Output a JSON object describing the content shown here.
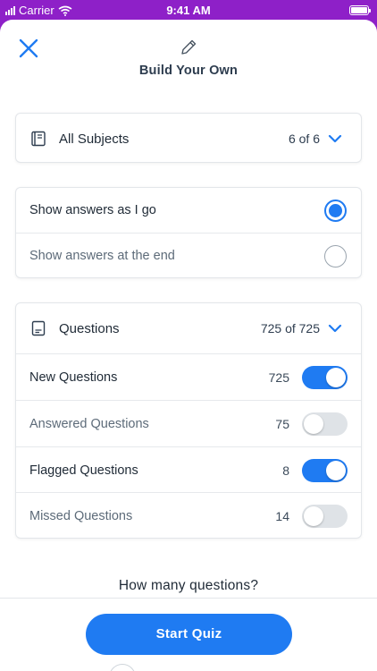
{
  "status_bar": {
    "carrier": "Carrier",
    "time": "9:41 AM"
  },
  "header": {
    "title": "Build Your Own"
  },
  "subjects": {
    "label": "All Subjects",
    "count": "6 of 6"
  },
  "answers": {
    "options": [
      {
        "label": "Show answers as I go",
        "selected": true
      },
      {
        "label": "Show answers at the end",
        "selected": false
      }
    ]
  },
  "questions": {
    "label": "Questions",
    "count": "725 of 725",
    "filters": [
      {
        "label": "New Questions",
        "count": "725",
        "enabled": true
      },
      {
        "label": "Answered Questions",
        "count": "75",
        "enabled": false
      },
      {
        "label": "Flagged Questions",
        "count": "8",
        "enabled": true
      },
      {
        "label": "Missed Questions",
        "count": "14",
        "enabled": false
      }
    ]
  },
  "how_many": {
    "label": "How many questions?"
  },
  "footer": {
    "start_label": "Start Quiz"
  },
  "colors": {
    "accent": "#1f7bf2",
    "status_bar": "#8e20c8"
  },
  "icons": [
    "close-icon",
    "pencil-icon",
    "book-icon",
    "chevron-down-icon",
    "document-icon"
  ]
}
